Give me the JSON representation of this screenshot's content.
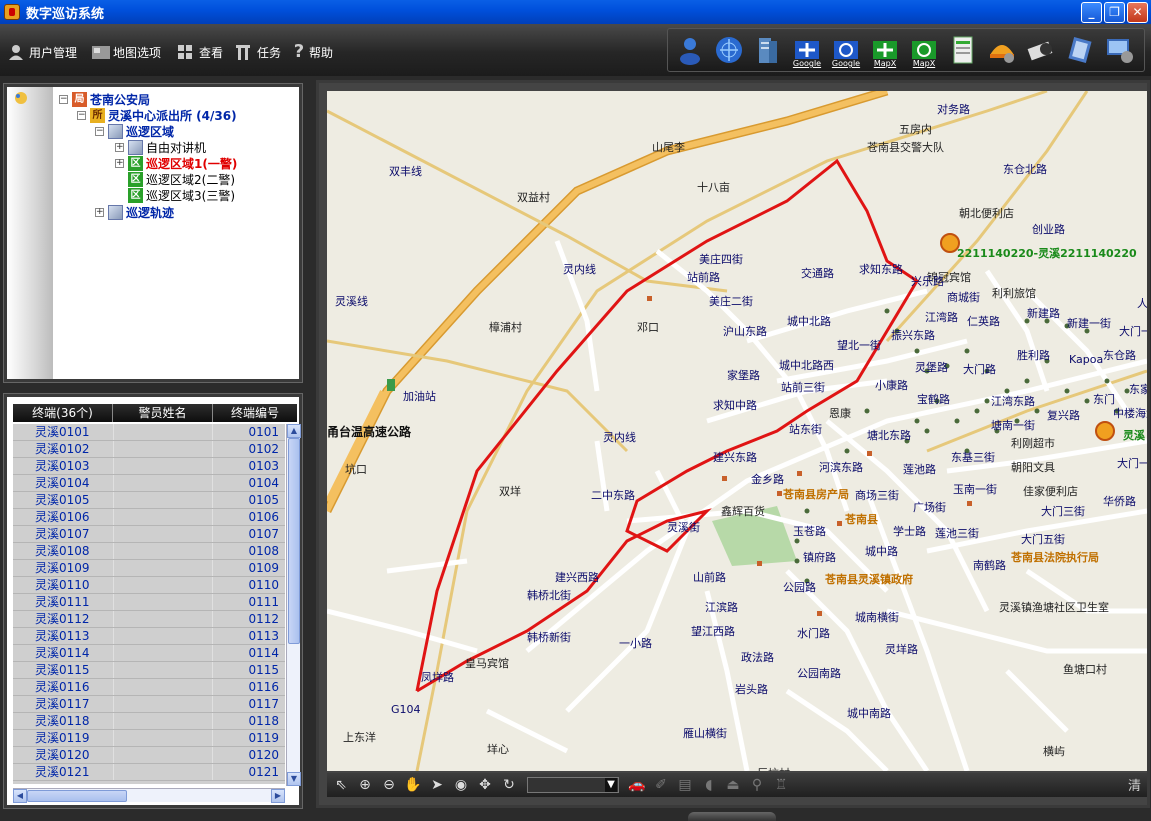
{
  "window": {
    "title": "数字巡访系统"
  },
  "menu": [
    {
      "label": "用户管理",
      "icon": "user-icon"
    },
    {
      "label": "地图选项",
      "icon": "map-options-icon"
    },
    {
      "label": "查看",
      "icon": "grid-icon"
    },
    {
      "label": "任务",
      "icon": "tools-icon"
    },
    {
      "label": "帮助",
      "icon": "help-icon"
    }
  ],
  "toolbar": {
    "google1": "Google",
    "google2": "Google",
    "mapx1": "MapX",
    "mapx2": "MapX"
  },
  "tree": {
    "root": "苍南公安局",
    "station": "灵溪中心派出所 (4/36)",
    "patrol_area": "巡逻区域",
    "intercom": "自由对讲机",
    "area1": "巡逻区域1(一警)",
    "area2": "巡逻区域2(二警)",
    "area3": "巡逻区域3(三警)",
    "track": "巡逻轨迹",
    "icon_ju": "局",
    "icon_suo": "所",
    "icon_qu": "区"
  },
  "list": {
    "headers": [
      "终端(36个)",
      "警员姓名",
      "终端编号"
    ],
    "rows": [
      [
        "灵溪0101",
        "",
        "0101"
      ],
      [
        "灵溪0102",
        "",
        "0102"
      ],
      [
        "灵溪0103",
        "",
        "0103"
      ],
      [
        "灵溪0104",
        "",
        "0104"
      ],
      [
        "灵溪0105",
        "",
        "0105"
      ],
      [
        "灵溪0106",
        "",
        "0106"
      ],
      [
        "灵溪0107",
        "",
        "0107"
      ],
      [
        "灵溪0108",
        "",
        "0108"
      ],
      [
        "灵溪0109",
        "",
        "0109"
      ],
      [
        "灵溪0110",
        "",
        "0110"
      ],
      [
        "灵溪0111",
        "",
        "0111"
      ],
      [
        "灵溪0112",
        "",
        "0112"
      ],
      [
        "灵溪0113",
        "",
        "0113"
      ],
      [
        "灵溪0114",
        "",
        "0114"
      ],
      [
        "灵溪0115",
        "",
        "0115"
      ],
      [
        "灵溪0116",
        "",
        "0116"
      ],
      [
        "灵溪0117",
        "",
        "0117"
      ],
      [
        "灵溪0118",
        "",
        "0118"
      ],
      [
        "灵溪0119",
        "",
        "0119"
      ],
      [
        "灵溪0120",
        "",
        "0120"
      ],
      [
        "灵溪0121",
        "",
        "0121"
      ]
    ]
  },
  "map": {
    "labels": [
      {
        "t": "对务路",
        "c": ""
      },
      {
        "t": "五房内",
        "c": "blk"
      },
      {
        "t": "苍南县交警大队",
        "c": "blk"
      },
      {
        "t": "东仓北路",
        "c": ""
      },
      {
        "t": "山尾李",
        "c": "blk"
      },
      {
        "t": "十八亩",
        "c": "blk"
      },
      {
        "t": "双益村",
        "c": "blk"
      },
      {
        "t": "双丰线",
        "c": ""
      },
      {
        "t": "朝北便利店",
        "c": "blk"
      },
      {
        "t": "创业路",
        "c": ""
      },
      {
        "t": "美庄四街",
        "c": ""
      },
      {
        "t": "站前路",
        "c": ""
      },
      {
        "t": "交通路",
        "c": ""
      },
      {
        "t": "求知东路",
        "c": ""
      },
      {
        "t": "锦冠宾馆",
        "c": "blk"
      },
      {
        "t": "灵内线",
        "c": ""
      },
      {
        "t": "灵溪线",
        "c": ""
      },
      {
        "t": "美庄二街",
        "c": ""
      },
      {
        "t": "商城街",
        "c": ""
      },
      {
        "t": "利利旅馆",
        "c": "blk"
      },
      {
        "t": "樟浦村",
        "c": "blk"
      },
      {
        "t": "邓口",
        "c": "blk"
      },
      {
        "t": "沪山东路",
        "c": ""
      },
      {
        "t": "城中北路",
        "c": ""
      },
      {
        "t": "江湾路",
        "c": ""
      },
      {
        "t": "仁英路",
        "c": ""
      },
      {
        "t": "新建路",
        "c": ""
      },
      {
        "t": "新建一街",
        "c": ""
      },
      {
        "t": "望北一街",
        "c": ""
      },
      {
        "t": "胜利路",
        "c": ""
      },
      {
        "t": "东仓路",
        "c": ""
      },
      {
        "t": "家堡路",
        "c": ""
      },
      {
        "t": "城中北路西",
        "c": ""
      },
      {
        "t": "灵堡路",
        "c": ""
      },
      {
        "t": "大门路",
        "c": ""
      },
      {
        "t": "加油站",
        "c": ""
      },
      {
        "t": "站前三街",
        "c": ""
      },
      {
        "t": "小康路",
        "c": ""
      },
      {
        "t": "求知中路",
        "c": ""
      },
      {
        "t": "宝鹤路",
        "c": ""
      },
      {
        "t": "江湾东路",
        "c": ""
      },
      {
        "t": "复兴路",
        "c": ""
      },
      {
        "t": "甬台温高速公路",
        "c": "big"
      },
      {
        "t": "站东街",
        "c": ""
      },
      {
        "t": "塘北东路",
        "c": ""
      },
      {
        "t": "塘南一街",
        "c": ""
      },
      {
        "t": "利刚超市",
        "c": "blk"
      },
      {
        "t": "灵内线",
        "c": ""
      },
      {
        "t": "建兴东路",
        "c": ""
      },
      {
        "t": "河滨东路",
        "c": ""
      },
      {
        "t": "莲池路",
        "c": ""
      },
      {
        "t": "东基三街",
        "c": ""
      },
      {
        "t": "坑口",
        "c": "blk"
      },
      {
        "t": "朝阳文具",
        "c": "blk"
      },
      {
        "t": "大门一街",
        "c": ""
      },
      {
        "t": "金乡路",
        "c": ""
      },
      {
        "t": "苍南县房产局",
        "c": "orn"
      },
      {
        "t": "商场三街",
        "c": ""
      },
      {
        "t": "玉南一街",
        "c": ""
      },
      {
        "t": "佳家便利店",
        "c": "blk"
      },
      {
        "t": "双垟",
        "c": "blk"
      },
      {
        "t": "二中东路",
        "c": ""
      },
      {
        "t": "鑫辉百货",
        "c": "blk"
      },
      {
        "t": "广场街",
        "c": ""
      },
      {
        "t": "华侨路",
        "c": ""
      },
      {
        "t": "大门三街",
        "c": ""
      },
      {
        "t": "灵溪街",
        "c": ""
      },
      {
        "t": "苍南县",
        "c": "orn"
      },
      {
        "t": "学士路",
        "c": ""
      },
      {
        "t": "莲池三街",
        "c": ""
      },
      {
        "t": "大门五街",
        "c": ""
      },
      {
        "t": "玉苍路",
        "c": ""
      },
      {
        "t": "城中路",
        "c": ""
      },
      {
        "t": "苍南县法院执行局",
        "c": "orn"
      },
      {
        "t": "镇府路",
        "c": ""
      },
      {
        "t": "南鹤路",
        "c": ""
      },
      {
        "t": "建兴西路",
        "c": ""
      },
      {
        "t": "山前路",
        "c": ""
      },
      {
        "t": "苍南县灵溪镇政府",
        "c": "orn"
      },
      {
        "t": "韩桥北街",
        "c": ""
      },
      {
        "t": "公园路",
        "c": ""
      },
      {
        "t": "江滨路",
        "c": ""
      },
      {
        "t": "灵溪镇渔塘社区卫生室",
        "c": "blk"
      },
      {
        "t": "城南横街",
        "c": ""
      },
      {
        "t": "韩桥新街",
        "c": ""
      },
      {
        "t": "一小路",
        "c": ""
      },
      {
        "t": "望江西路",
        "c": ""
      },
      {
        "t": "水门路",
        "c": ""
      },
      {
        "t": "灵垟路",
        "c": ""
      },
      {
        "t": "皇马宾馆",
        "c": "blk"
      },
      {
        "t": "政法路",
        "c": ""
      },
      {
        "t": "凤垟路",
        "c": ""
      },
      {
        "t": "公园南路",
        "c": ""
      },
      {
        "t": "鱼塘口村",
        "c": "blk"
      },
      {
        "t": "岩头路",
        "c": ""
      },
      {
        "t": "G104",
        "c": ""
      },
      {
        "t": "城中南路",
        "c": ""
      },
      {
        "t": "上东洋",
        "c": "blk"
      },
      {
        "t": "垟心",
        "c": "blk"
      },
      {
        "t": "雁山横街",
        "c": ""
      },
      {
        "t": "横屿",
        "c": "blk"
      },
      {
        "t": "巨坑村",
        "c": "blk"
      },
      {
        "t": "2211140220-灵溪2211140220",
        "c": "grn"
      },
      {
        "t": "东门",
        "c": ""
      },
      {
        "t": "Kapoa",
        "c": ""
      },
      {
        "t": "大门一",
        "c": ""
      },
      {
        "t": "人",
        "c": ""
      },
      {
        "t": "东家宾",
        "c": ""
      },
      {
        "t": "中楼海鲜",
        "c": ""
      },
      {
        "t": "灵溪",
        "c": "grn"
      },
      {
        "t": "兴乐路",
        "c": ""
      },
      {
        "t": "振兴东路",
        "c": ""
      },
      {
        "t": "恩康",
        "c": "blk"
      }
    ]
  },
  "maptools": {
    "clear_label": "清"
  }
}
